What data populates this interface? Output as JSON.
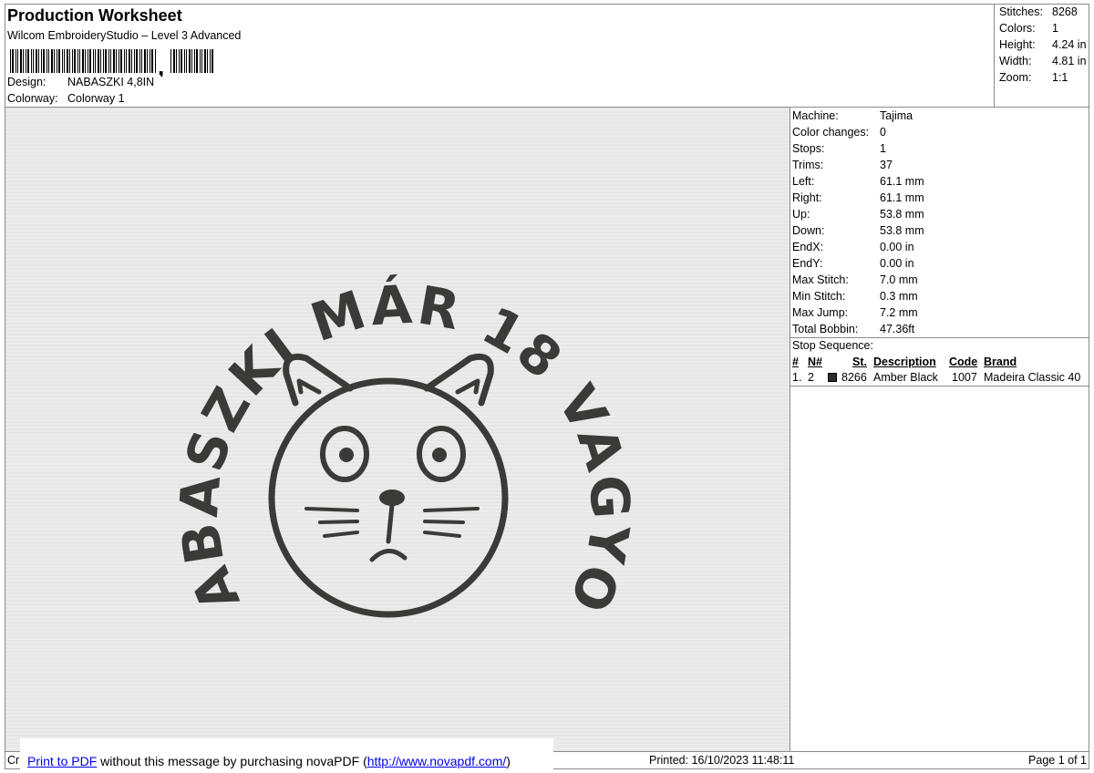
{
  "header": {
    "title": "Production Worksheet",
    "subtitle": "Wilcom EmbroideryStudio – Level 3 Advanced",
    "barcode_char": ",",
    "design_label": "Design:",
    "design_value": "NABASZKI 4,8IN",
    "colorway_label": "Colorway:",
    "colorway_value": "Colorway 1"
  },
  "summary": [
    {
      "label": "Stitches:",
      "value": "8268"
    },
    {
      "label": "Colors:",
      "value": "1"
    },
    {
      "label": "Height:",
      "value": "4.24 in"
    },
    {
      "label": "Width:",
      "value": "4.81 in"
    },
    {
      "label": "Zoom:",
      "value": "1:1"
    }
  ],
  "design": {
    "arc_text": "NABASZKI MÁR 18 VAGYOK",
    "thread_color": "#3a3a38"
  },
  "machine": [
    {
      "label": "Machine:",
      "value": "Tajima"
    },
    {
      "label": "Color changes:",
      "value": "0"
    },
    {
      "label": "Stops:",
      "value": "1"
    },
    {
      "label": "Trims:",
      "value": "37"
    },
    {
      "label": "Left:",
      "value": "61.1 mm"
    },
    {
      "label": "Right:",
      "value": "61.1 mm"
    },
    {
      "label": "Up:",
      "value": "53.8 mm"
    },
    {
      "label": "Down:",
      "value": "53.8 mm"
    },
    {
      "label": "EndX:",
      "value": "0.00 in"
    },
    {
      "label": "EndY:",
      "value": "0.00 in"
    },
    {
      "label": "Max Stitch:",
      "value": "7.0 mm"
    },
    {
      "label": "Min Stitch:",
      "value": "0.3 mm"
    },
    {
      "label": "Max Jump:",
      "value": "7.2 mm"
    },
    {
      "label": "Total Bobbin:",
      "value": "47.36ft"
    }
  ],
  "stop_sequence": {
    "title": "Stop Sequence:",
    "headers": {
      "num": "#",
      "n": "N#",
      "st": "St.",
      "description": "Description",
      "code": "Code",
      "brand": "Brand"
    },
    "rows": [
      {
        "num": "1.",
        "n": "2",
        "color": "#2b2b2b",
        "st": "8266",
        "description": "Amber Black",
        "code": "1007",
        "brand": "Madeira Classic 40"
      }
    ]
  },
  "footer": {
    "left_text": "Cr",
    "pdf_link": "Print to PDF",
    "pdf_middle": " without this message by purchasing novaPDF (",
    "pdf_url": "http://www.novapdf.com/",
    "pdf_end": ")",
    "printed": "Printed: 16/10/2023 11:48:11",
    "page": "Page 1 of 1"
  }
}
